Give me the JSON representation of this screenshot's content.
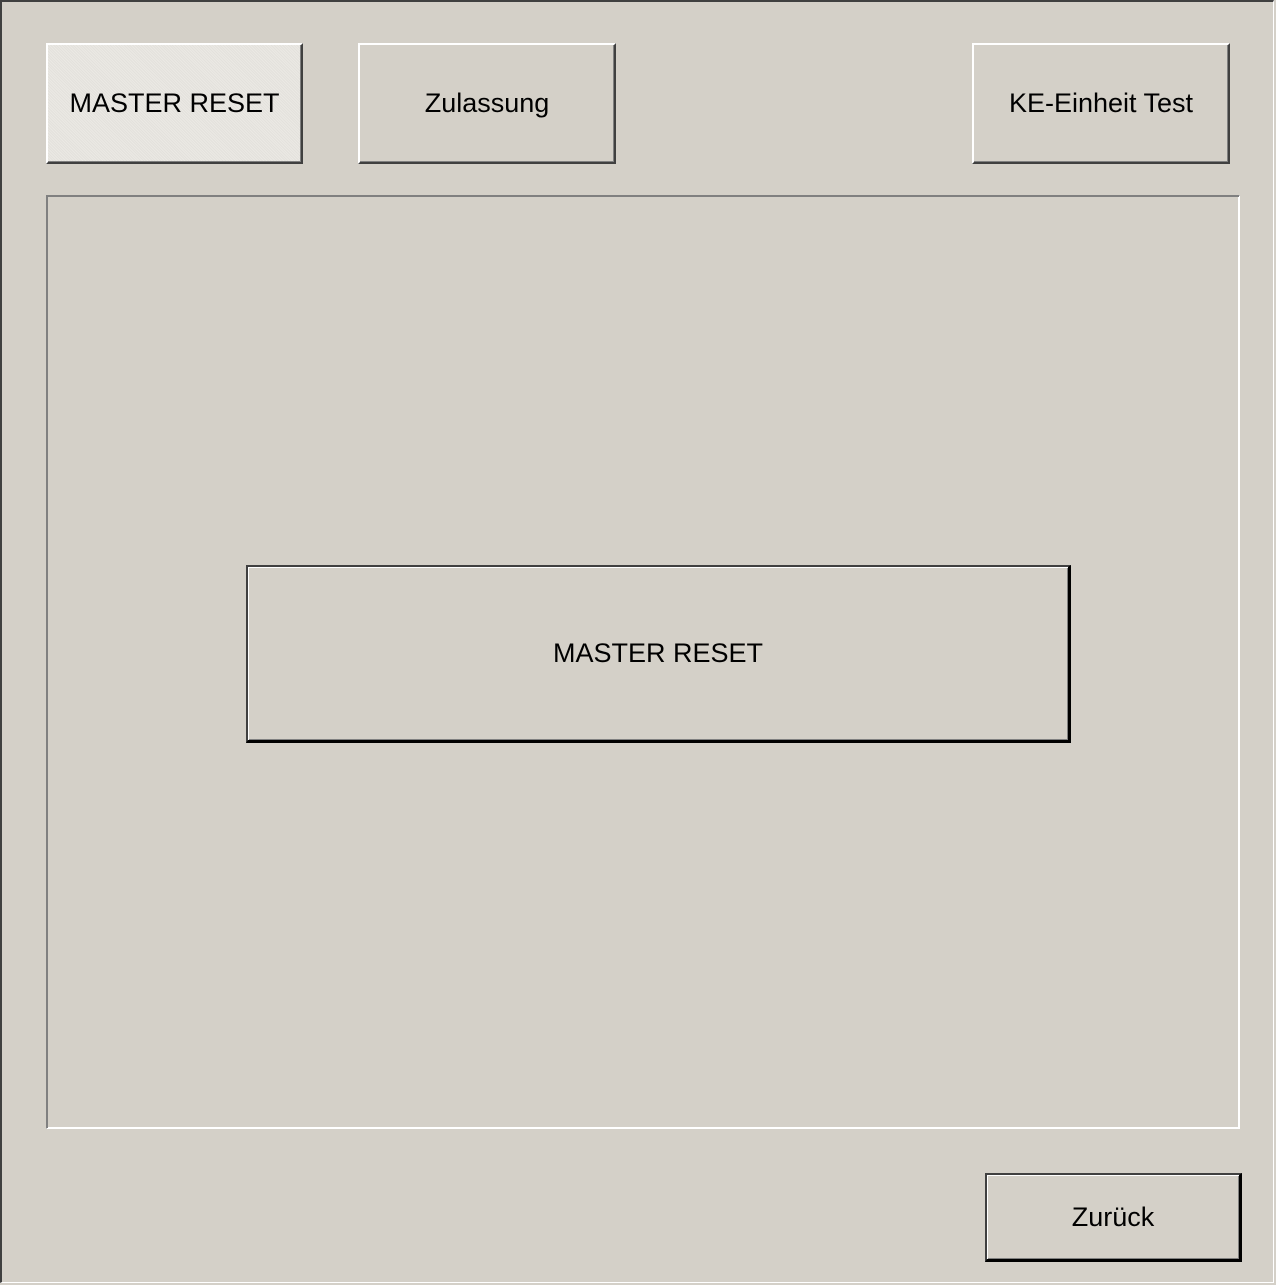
{
  "tabs": {
    "master_reset": "MASTER RESET",
    "zulassung": "Zulassung",
    "ke_einheit_test": "KE-Einheit Test"
  },
  "panel": {
    "master_reset_button": "MASTER RESET"
  },
  "footer": {
    "back_button": "Zurück"
  },
  "colors": {
    "face": "#d4d0c8",
    "highlight": "#ffffff",
    "shadow": "#808080",
    "dark_shadow": "#404040"
  }
}
